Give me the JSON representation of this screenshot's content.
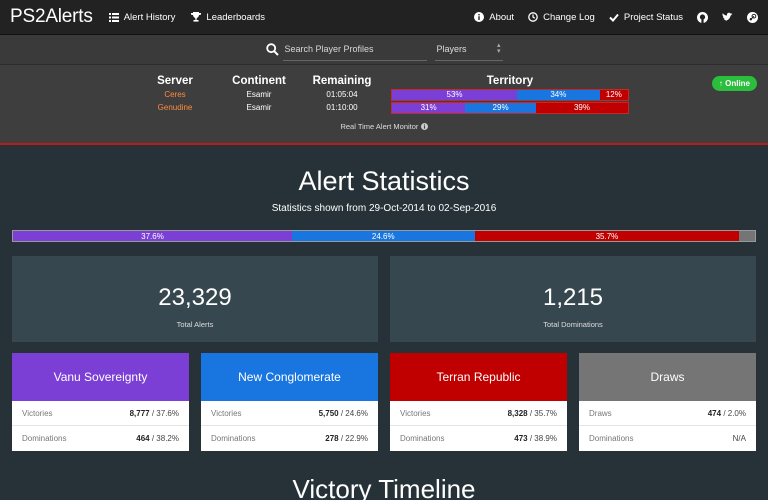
{
  "navbar": {
    "brand": "PS2Alerts",
    "alert_history": "Alert History",
    "leaderboards": "Leaderboards",
    "about": "About",
    "change_log": "Change Log",
    "project_status": "Project Status"
  },
  "search": {
    "placeholder": "Search Player Profiles",
    "select_value": "Players"
  },
  "monitor": {
    "headers": {
      "server": "Server",
      "continent": "Continent",
      "remaining": "Remaining",
      "territory": "Territory"
    },
    "rows": [
      {
        "server": "Ceres",
        "continent": "Esamir",
        "remaining": "01:05:04",
        "vs": "53%",
        "nc": "34%",
        "tr": "12%"
      },
      {
        "server": "Genudine",
        "continent": "Esamir",
        "remaining": "01:10:00",
        "vs": "31%",
        "nc": "29%",
        "tr": "39%"
      }
    ],
    "label": "Real Time Alert Monitor",
    "status": "Online"
  },
  "stats": {
    "title": "Alert Statistics",
    "subtitle": "Statistics shown from 29-Oct-2014 to 02-Sep-2016",
    "overall": {
      "vs": "37.6%",
      "nc": "24.6%",
      "tr": "35.7%"
    },
    "total_alerts": "23,329",
    "total_alerts_label": "Total Alerts",
    "total_dominations": "1,215",
    "total_dominations_label": "Total Dominations"
  },
  "factions": {
    "vs": {
      "name": "Vanu Sovereignty",
      "r1_label": "Victories",
      "r1_num": "8,777",
      "r1_pct": " / 37.6%",
      "r2_label": "Dominations",
      "r2_num": "464",
      "r2_pct": " / 38.2%"
    },
    "nc": {
      "name": "New Conglomerate",
      "r1_label": "Victories",
      "r1_num": "5,750",
      "r1_pct": " / 24.6%",
      "r2_label": "Dominations",
      "r2_num": "278",
      "r2_pct": " / 22.9%"
    },
    "tr": {
      "name": "Terran Republic",
      "r1_label": "Victories",
      "r1_num": "8,328",
      "r1_pct": " / 35.7%",
      "r2_label": "Dominations",
      "r2_num": "473",
      "r2_pct": " / 38.9%"
    },
    "draws": {
      "name": "Draws",
      "r1_label": "Draws",
      "r1_num": "474",
      "r1_pct": " / 2.0%",
      "r2_label": "Dominations",
      "r2_num": "N/A",
      "r2_pct": ""
    }
  },
  "timeline": {
    "title": "Victory Timeline"
  },
  "colors": {
    "vs": "#7b3fd6",
    "nc": "#1976e0",
    "tr": "#c00000",
    "draw": "#757575"
  }
}
